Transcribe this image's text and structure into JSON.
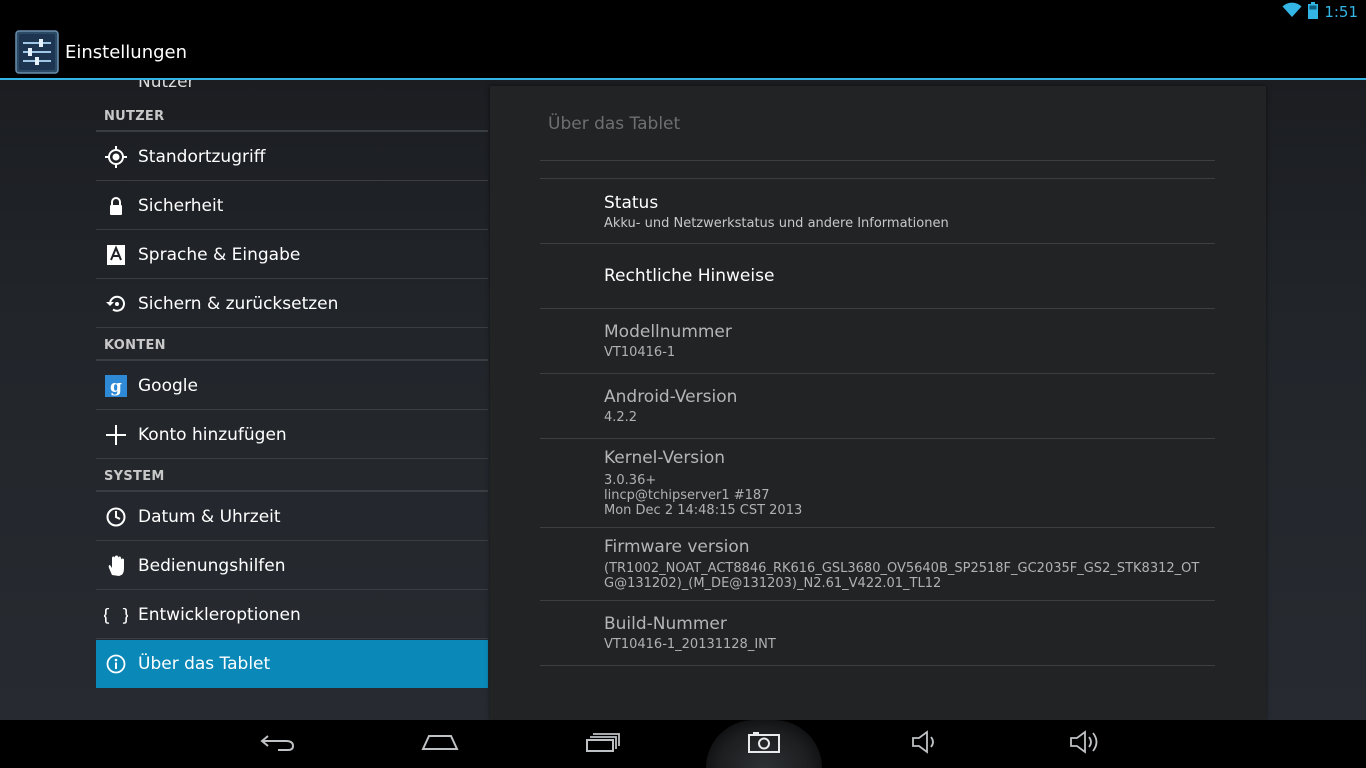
{
  "status": {
    "time": "1:51"
  },
  "app": {
    "title": "Einstellungen"
  },
  "sidebar": {
    "clipped_item": "Nutzer",
    "sections": {
      "nutzer": "NUTZER",
      "konten": "KONTEN",
      "system": "SYSTEM"
    },
    "items": [
      {
        "label": "Standortzugriff",
        "icon": "location-icon"
      },
      {
        "label": "Sicherheit",
        "icon": "lock-icon"
      },
      {
        "label": "Sprache & Eingabe",
        "icon": "language-icon"
      },
      {
        "label": "Sichern & zurücksetzen",
        "icon": "backup-restore-icon"
      },
      {
        "label": "Google",
        "icon": "google-icon"
      },
      {
        "label": "Konto hinzufügen",
        "icon": "plus-icon"
      },
      {
        "label": "Datum & Uhrzeit",
        "icon": "clock-icon"
      },
      {
        "label": "Bedienungshilfen",
        "icon": "hand-icon"
      },
      {
        "label": "Entwickleroptionen",
        "icon": "braces-icon"
      },
      {
        "label": "Über das Tablet",
        "icon": "info-icon"
      }
    ],
    "selected_index": 9
  },
  "detail": {
    "title": "Über das Tablet",
    "rows": [
      {
        "title": "Status",
        "summary": [
          "Akku- und Netzwerkstatus und andere Informationen"
        ]
      },
      {
        "title": "Rechtliche Hinweise",
        "summary": []
      },
      {
        "title": "Modellnummer",
        "summary": [
          "VT10416-1"
        ]
      },
      {
        "title": "Android-Version",
        "summary": [
          "4.2.2"
        ]
      },
      {
        "title": "Kernel-Version",
        "summary": [
          "3.0.36+",
          "lincp@tchipserver1 #187",
          "Mon Dec 2 14:48:15 CST 2013"
        ]
      },
      {
        "title": "Firmware version",
        "summary": [
          "(TR1002_NOAT_ACT8846_RK616_GSL3680_OV5640B_SP2518F_GC2035F_GS2_STK8312_OT",
          "G@131202)_(M_DE@131203)_N2.61_V422.01_TL12"
        ]
      },
      {
        "title": "Build-Nummer",
        "summary": [
          "VT10416-1_20131128_INT"
        ]
      }
    ]
  },
  "navbar": {
    "buttons": [
      "back-icon",
      "home-icon",
      "recent-apps-icon",
      "screenshot-icon",
      "volume-down-icon",
      "volume-up-icon"
    ]
  },
  "colors": {
    "accent": "#33b5e5",
    "selected": "#0a88b8"
  }
}
